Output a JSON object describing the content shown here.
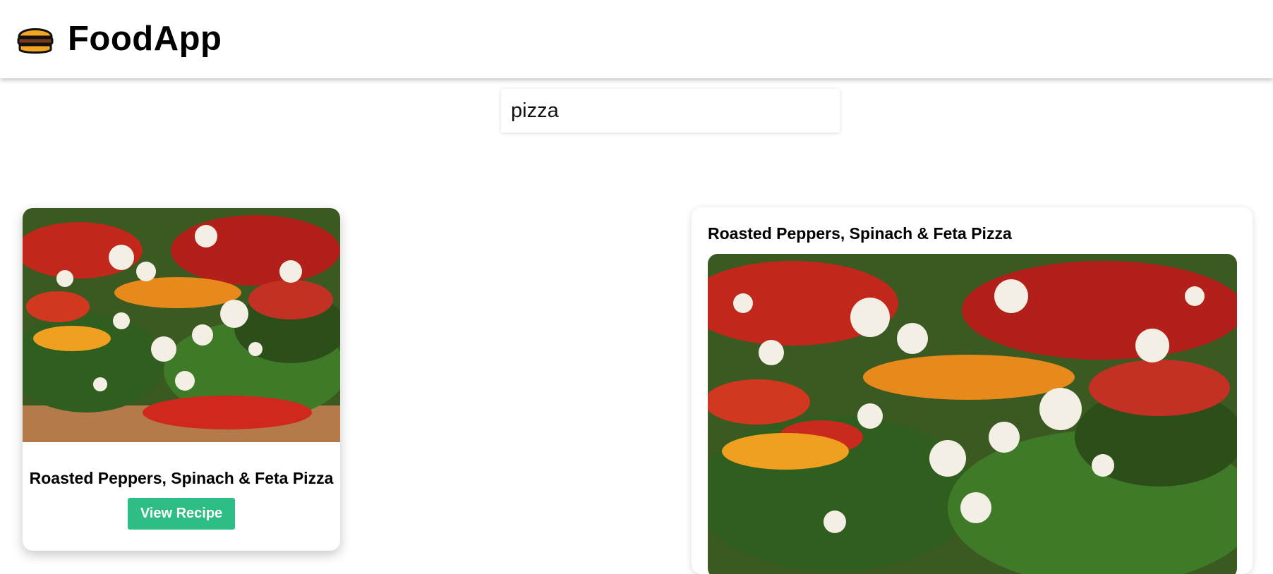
{
  "header": {
    "title": "FoodApp",
    "logo_icon": "burger-icon"
  },
  "search": {
    "value": "pizza",
    "placeholder": ""
  },
  "results": [
    {
      "title": "Roasted Peppers, Spinach & Feta Pizza",
      "button_label": "View Recipe",
      "image_icon": "pizza-photo"
    }
  ],
  "detail": {
    "title": "Roasted Peppers, Spinach & Feta Pizza",
    "image_icon": "pizza-photo"
  },
  "colors": {
    "accent": "#2ebd85",
    "header_bg": "#ffffff",
    "page_bg": "#ffffff"
  }
}
